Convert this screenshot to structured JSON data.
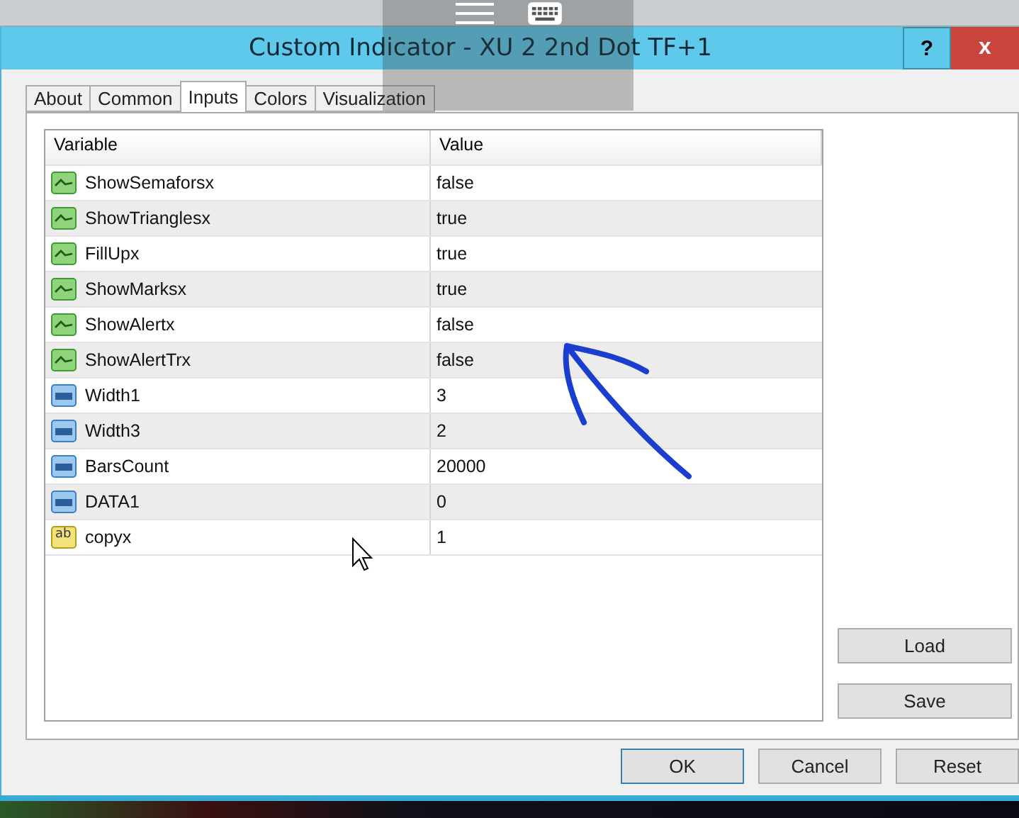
{
  "window": {
    "title": "Custom Indicator - XU  2 2nd Dot TF+1",
    "help_button": "?",
    "close_button": "x"
  },
  "tabs": [
    {
      "label": "About",
      "selected": false
    },
    {
      "label": "Common",
      "selected": false
    },
    {
      "label": "Inputs",
      "selected": true
    },
    {
      "label": "Colors",
      "selected": false
    },
    {
      "label": "Visualization",
      "selected": false
    }
  ],
  "table": {
    "columns": [
      "Variable",
      "Value"
    ],
    "rows": [
      {
        "kind": "bool",
        "variable": "ShowSemaforsx",
        "value": "false"
      },
      {
        "kind": "bool",
        "variable": "ShowTrianglesx",
        "value": "true"
      },
      {
        "kind": "bool",
        "variable": "FillUpx",
        "value": "true"
      },
      {
        "kind": "bool",
        "variable": "ShowMarksx",
        "value": "true"
      },
      {
        "kind": "bool",
        "variable": "ShowAlertx",
        "value": "false"
      },
      {
        "kind": "bool",
        "variable": "ShowAlertTrx",
        "value": "false"
      },
      {
        "kind": "int",
        "variable": "Width1",
        "value": "3"
      },
      {
        "kind": "int",
        "variable": "Width3",
        "value": "2"
      },
      {
        "kind": "int",
        "variable": "BarsCount",
        "value": "20000"
      },
      {
        "kind": "int",
        "variable": "DATA1",
        "value": "0"
      },
      {
        "kind": "string",
        "variable": "copyx",
        "value": "1",
        "icon_text": "ab"
      }
    ]
  },
  "side_buttons": [
    "Load",
    "Save"
  ],
  "footer_buttons": [
    "OK",
    "Cancel",
    "Reset"
  ]
}
